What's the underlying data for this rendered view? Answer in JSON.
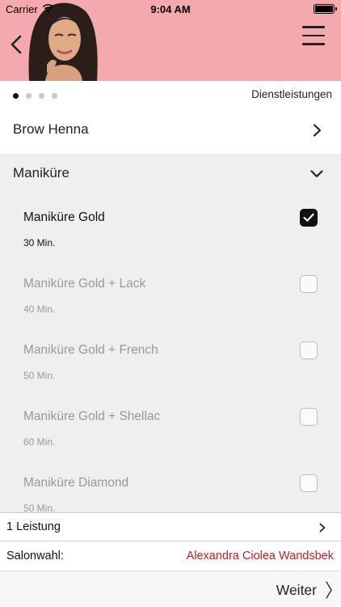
{
  "status_bar": {
    "carrier": "Carrier",
    "time": "9:04 AM"
  },
  "header": {
    "background_color": "#f3a9ad",
    "back_icon": "chevron-left-icon",
    "menu_icon": "hamburger-menu-icon"
  },
  "pager": {
    "page_count": 4,
    "active_index": 0,
    "label": "Dienstleistungen"
  },
  "categories": [
    {
      "label": "Brow Henna",
      "expanded": false
    },
    {
      "label": "Maniküre",
      "expanded": true
    }
  ],
  "services": [
    {
      "name": "Maniküre Gold",
      "duration": "30 Min.",
      "selected": true
    },
    {
      "name": "Maniküre Gold + Lack",
      "duration": "40 Min.",
      "selected": false
    },
    {
      "name": "Maniküre Gold + French",
      "duration": "50 Min.",
      "selected": false
    },
    {
      "name": "Maniküre Gold + Shellac",
      "duration": "60 Min.",
      "selected": false
    },
    {
      "name": "Maniküre Diamond",
      "duration": "50 Min.",
      "selected": false
    }
  ],
  "summary": {
    "label": "1 Leistung"
  },
  "salon": {
    "label": "Salonwahl:",
    "value": "Alexandra Ciolea Wandsbek",
    "value_color": "#c41e25"
  },
  "footer": {
    "next_label": "Weiter"
  }
}
